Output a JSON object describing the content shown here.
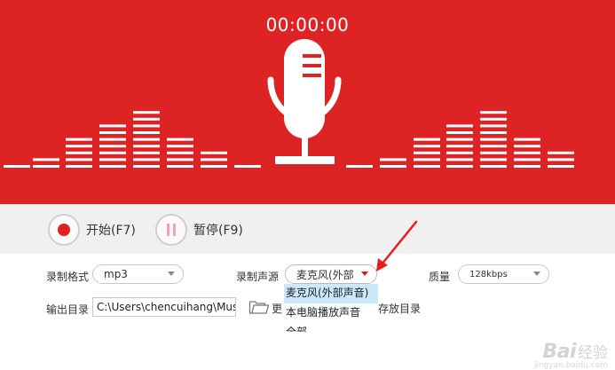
{
  "timer": "00:00:00",
  "colors": {
    "accent": "#dd2323",
    "record_dot": "#e0201f",
    "pause": "#f3a5a5",
    "highlight": "#cce8fb",
    "annotation_arrow": "#e81c1c"
  },
  "visualizer": {
    "bar_levels": [
      1,
      2,
      5,
      7,
      9,
      5,
      3,
      1,
      1,
      2,
      5,
      7,
      9,
      5,
      3
    ],
    "max_level": 9
  },
  "controls": {
    "start": {
      "label": "开始(F7)",
      "icon": "record-icon"
    },
    "pause": {
      "label": "暂停(F9)",
      "icon": "pause-icon"
    }
  },
  "settings": {
    "format": {
      "label": "录制格式",
      "value": "mp3"
    },
    "source": {
      "label": "录制声源",
      "value": "麦克风(外部"
    },
    "quality": {
      "label": "质量",
      "value": "128kbps"
    },
    "output": {
      "label": "输出目录",
      "path": "C:\\Users\\chencuihang\\Music",
      "change_label": "更",
      "open_label": "存放目录"
    }
  },
  "dropdown": {
    "options": [
      "麦克风(外部声音)",
      "本电脑播放声音",
      "全部"
    ],
    "selected_index": 0
  },
  "watermark": {
    "brand": "Bai",
    "cn": "经验",
    "url": "jingyan.baidu.com"
  }
}
